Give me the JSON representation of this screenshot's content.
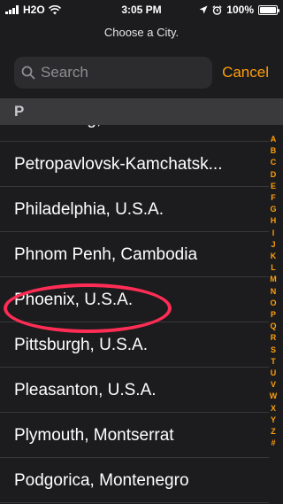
{
  "status_bar": {
    "carrier": "H2O",
    "time": "3:05 PM",
    "battery": "100%",
    "battery_level": 1.0
  },
  "header": {
    "title": "Choose a City."
  },
  "search": {
    "placeholder": "Search",
    "cancel_label": "Cancel"
  },
  "section": {
    "letter": "P"
  },
  "cities": [
    "Petersburg, U.S.A.",
    "Petropavlovsk-Kamchatsk...",
    "Philadelphia, U.S.A.",
    "Phnom Penh, Cambodia",
    "Phoenix, U.S.A.",
    "Pittsburgh, U.S.A.",
    "Pleasanton, U.S.A.",
    "Plymouth, Montserrat",
    "Podgorica, Montenegro"
  ],
  "index": [
    "A",
    "B",
    "C",
    "D",
    "E",
    "F",
    "G",
    "H",
    "I",
    "J",
    "K",
    "L",
    "M",
    "N",
    "O",
    "P",
    "Q",
    "R",
    "S",
    "T",
    "U",
    "V",
    "W",
    "X",
    "Y",
    "Z",
    "#"
  ],
  "highlight": {
    "color": "#ff2d55",
    "target_city_index": 4
  },
  "colors": {
    "accent": "#ff9f0a",
    "background": "#1c1c1e"
  }
}
